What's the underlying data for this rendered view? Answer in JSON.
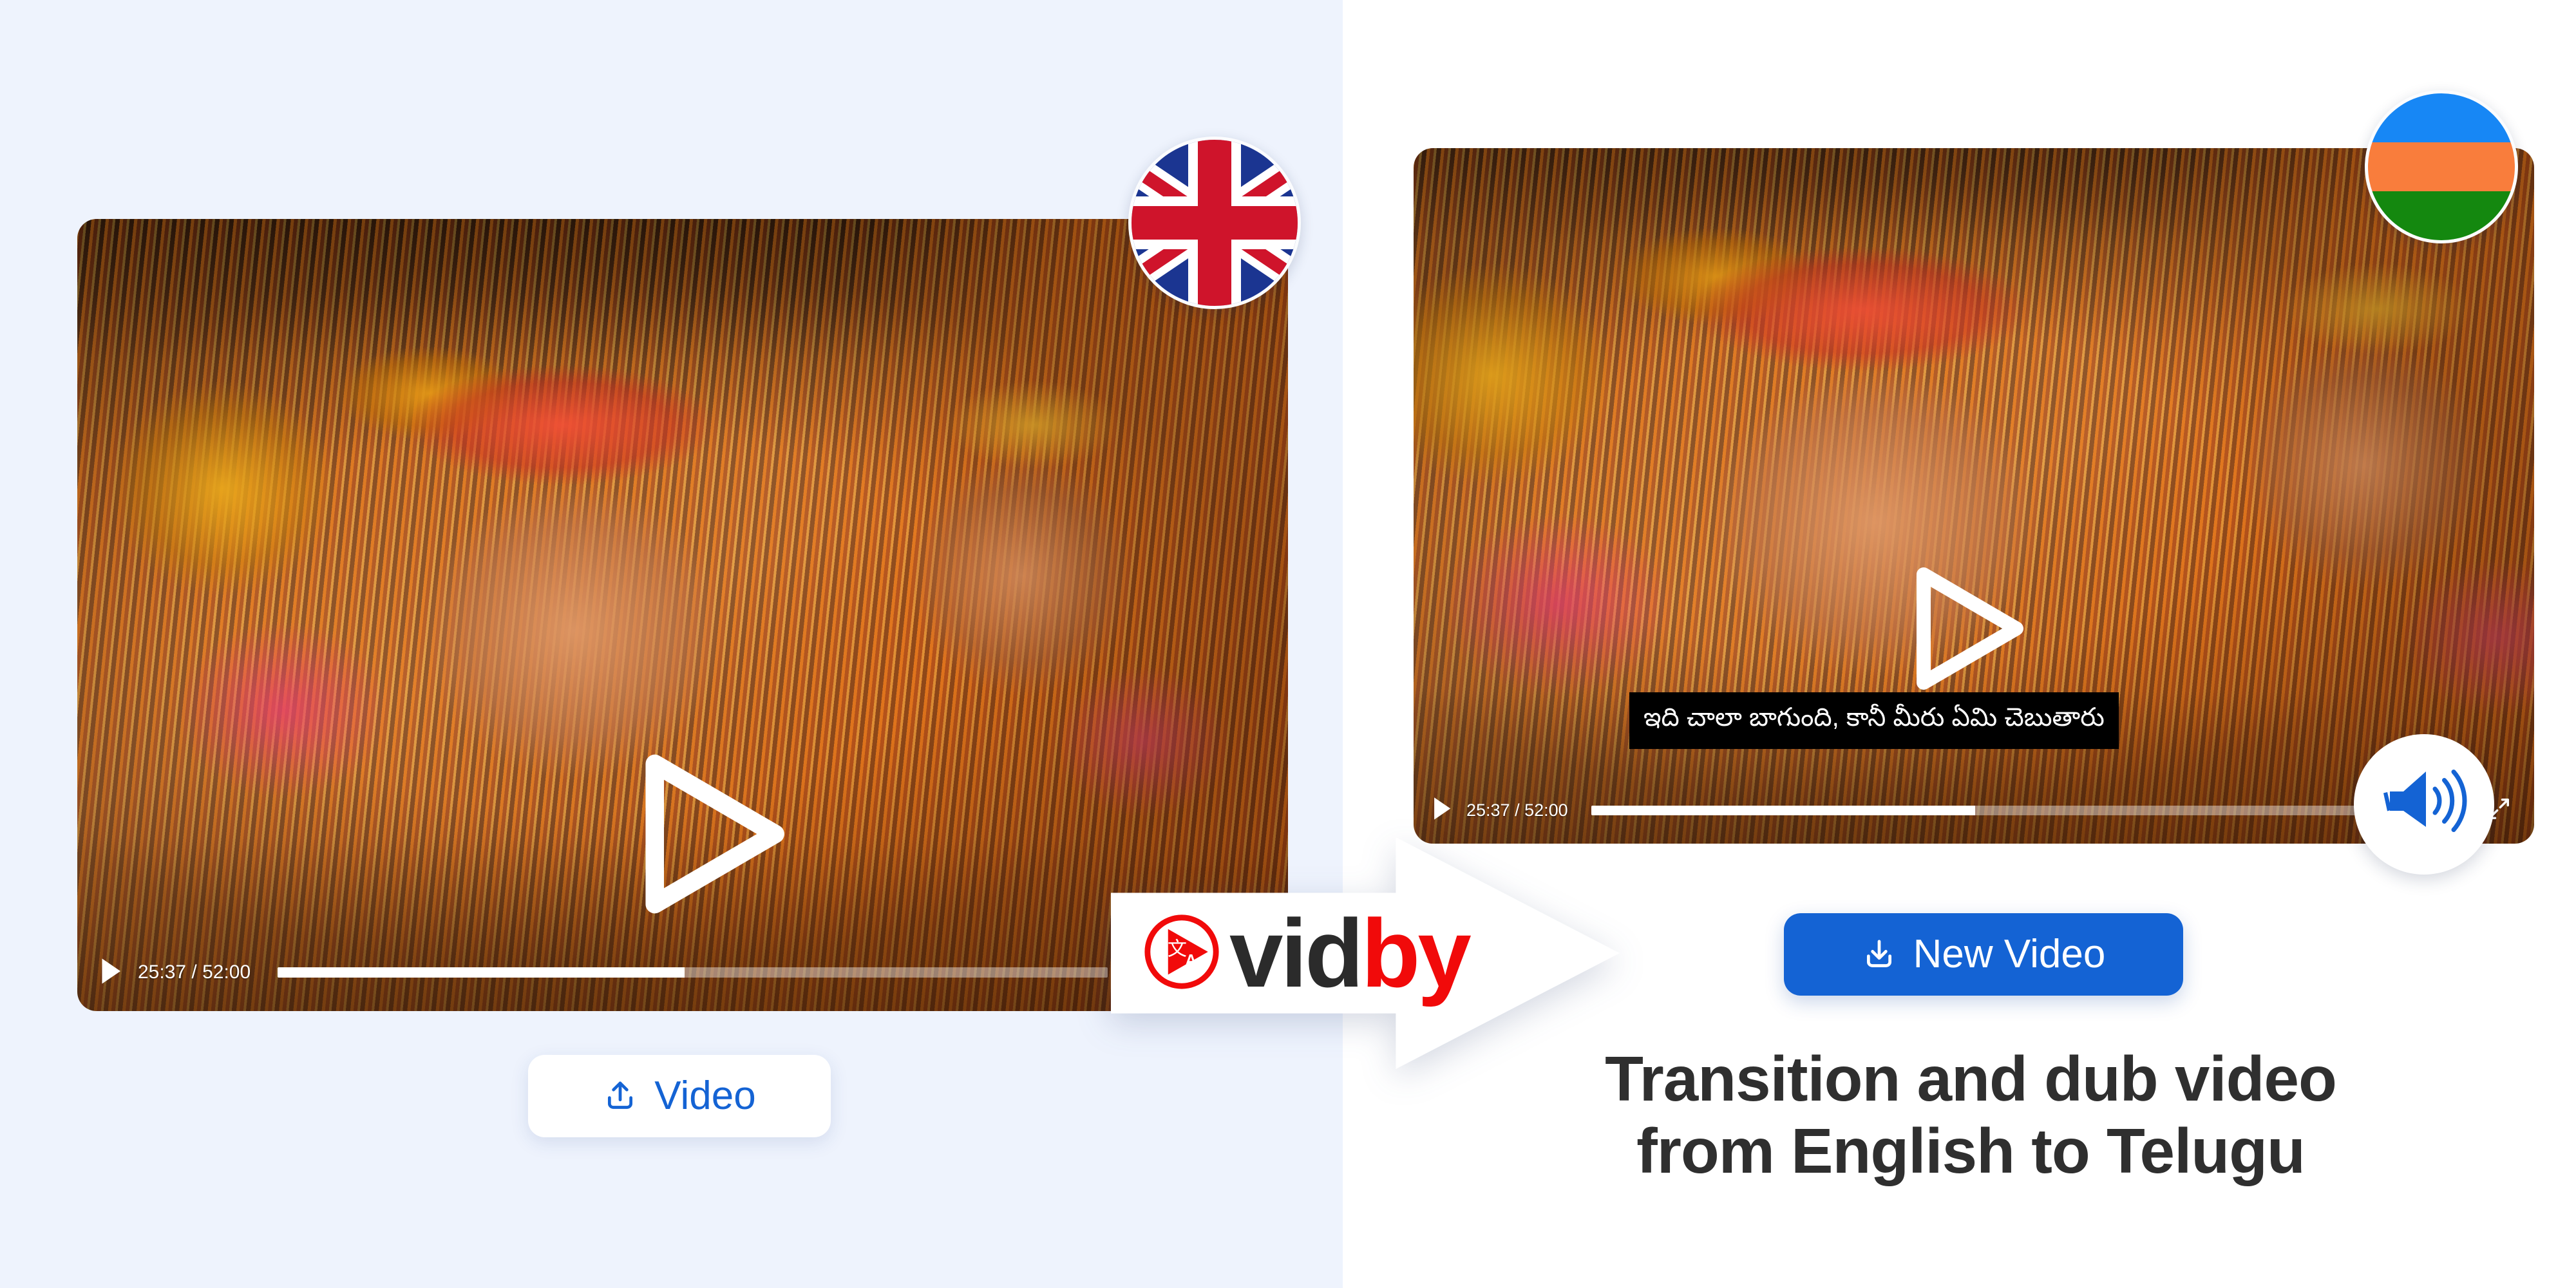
{
  "theme": {
    "left_panel_bg": "#eef3fd",
    "right_panel_bg": "#ffffff",
    "brand_blue": "#1463d4",
    "brand_red": "#f10a0a",
    "logo_dark": "#2b2b2b",
    "headline_color": "#2f2f2f",
    "subtitle_bg": "#000000",
    "subtitle_color": "#ffffff"
  },
  "source_panel": {
    "name": "source-video-panel",
    "flag_badge": {
      "icon": "uk-flag-icon",
      "language": "English",
      "alt": "United Kingdom flag"
    },
    "player": {
      "play_overlay_icon": "play-triangle-icon",
      "controls": {
        "play_icon": "play-icon",
        "time": "25:37 / 52:00",
        "current_time": "25:37",
        "duration": "52:00",
        "progress_percent": 49,
        "settings_icon": "gear-icon",
        "theater_icon": "theater-mode-icon",
        "fullscreen_icon": "fullscreen-icon"
      }
    },
    "upload_button": {
      "label": "Video",
      "icon": "upload-icon"
    }
  },
  "arrow": {
    "name": "translate-arrow",
    "logo": {
      "icon": "vidby-translate-icon",
      "text_part_1": "vid",
      "text_part_2": "by",
      "full_text": "vidby"
    }
  },
  "result_panel": {
    "name": "translated-video-panel",
    "flag_badge": {
      "icon": "telugu-flag-icon",
      "language": "Telugu",
      "alt": "Tricolor flag, blue orange green",
      "stripes": [
        "#1787f5",
        "#f97d3c",
        "#14880f"
      ]
    },
    "player": {
      "play_overlay_icon": "play-triangle-icon",
      "subtitle_text": "ఇది చాలా బాగుంది, కానీ మీరు ఏమి చెబుతారు",
      "controls": {
        "play_icon": "play-icon",
        "time": "25:37 / 52:00",
        "current_time": "25:37",
        "duration": "52:00",
        "progress_percent": 49,
        "settings_icon": "gear-icon",
        "theater_icon": "theater-mode-icon",
        "fullscreen_icon": "fullscreen-icon"
      }
    },
    "audio_badge": {
      "icon": "speaker-volume-icon",
      "alt": "Dubbed audio enabled"
    },
    "download_button": {
      "label": "New Video",
      "icon": "download-icon"
    },
    "headline": {
      "line_1": "Transition and dub video",
      "line_2": "from English to Telugu"
    }
  }
}
